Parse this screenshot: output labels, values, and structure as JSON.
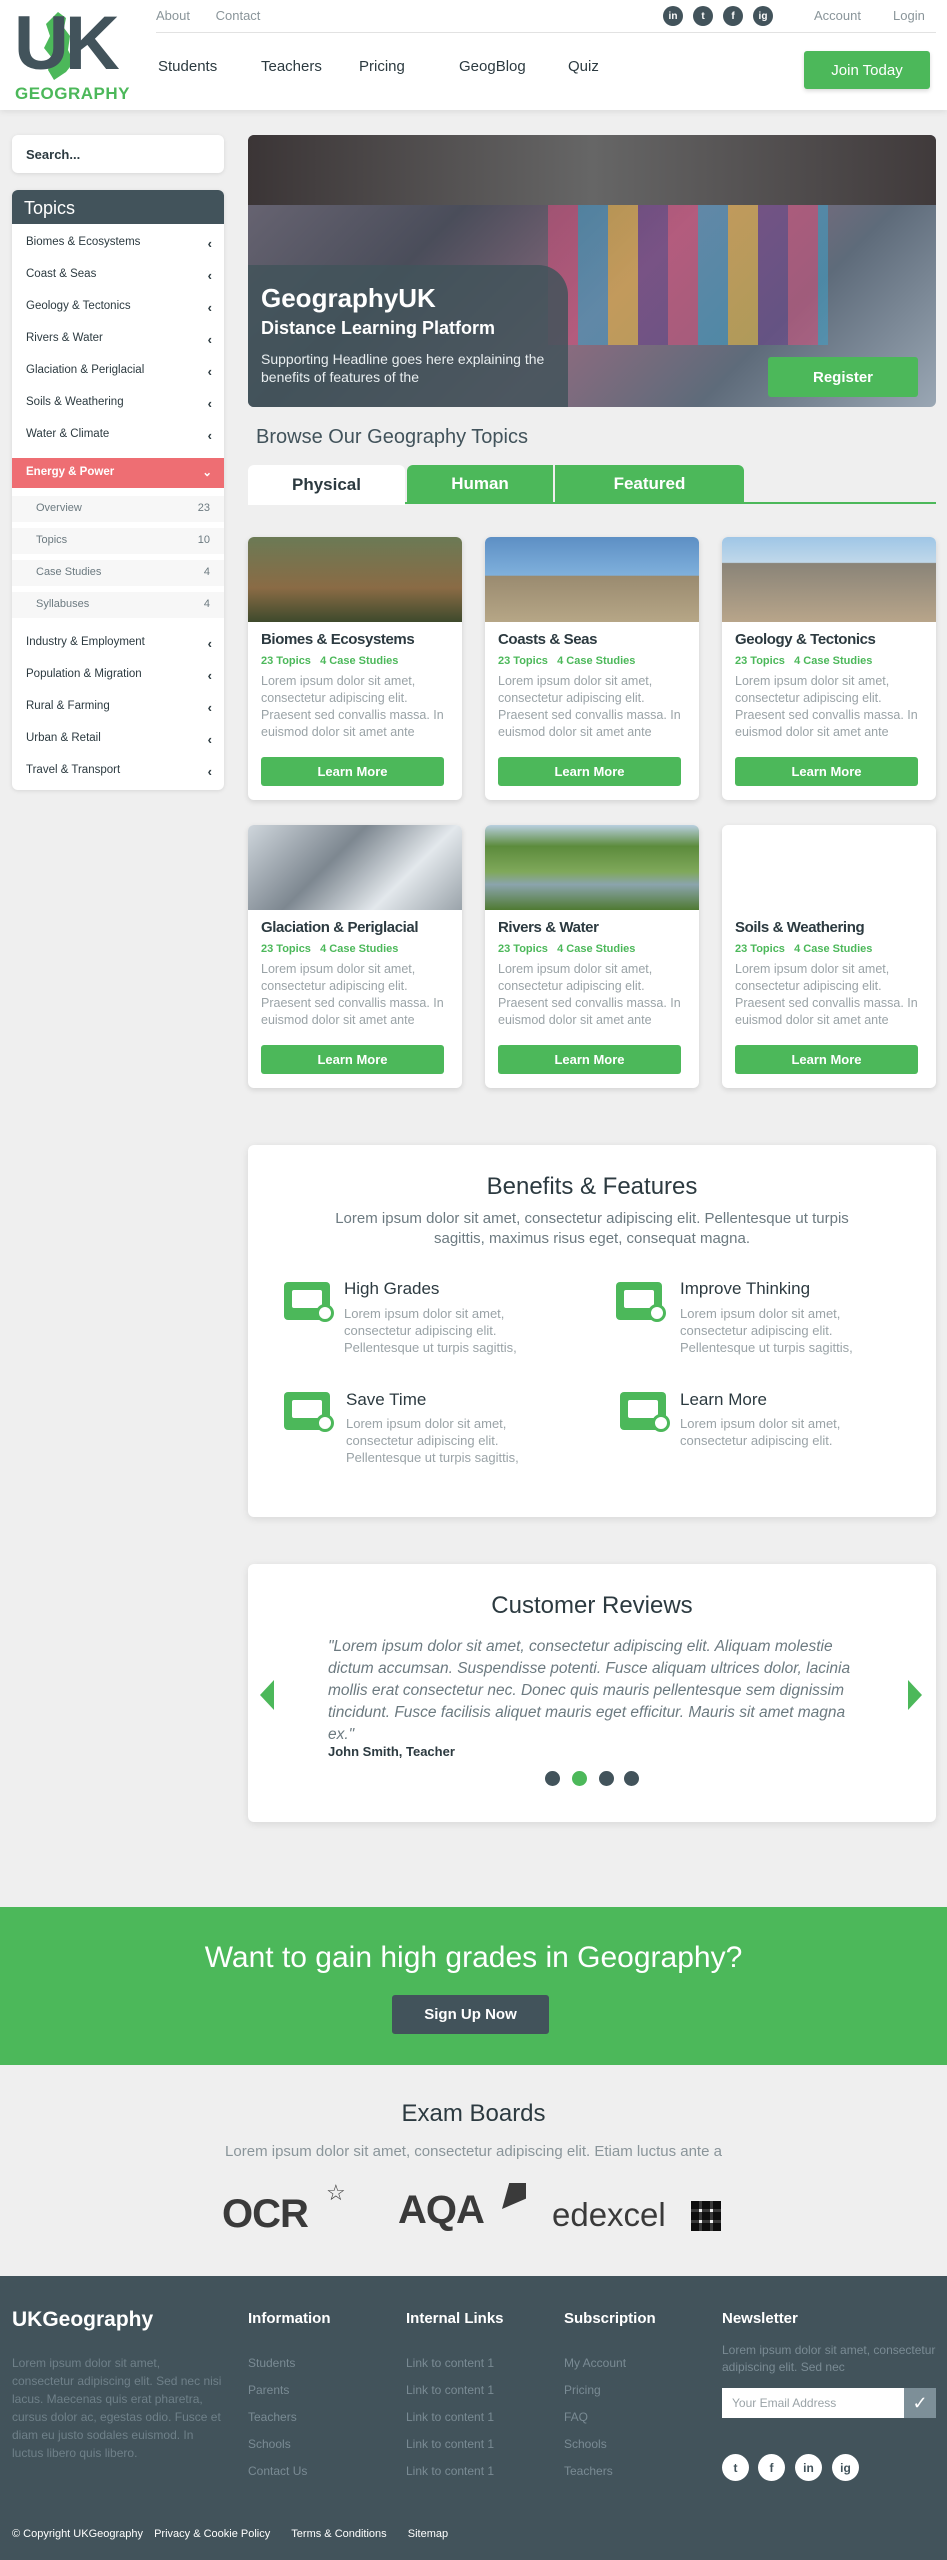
{
  "header": {
    "logo_text": "UK",
    "logo_sub": "GEOGRAPHY",
    "top_links": [
      "About",
      "Contact"
    ],
    "social": [
      "in",
      "t",
      "f",
      "ig"
    ],
    "account": "Account",
    "login": "Login",
    "nav": [
      "Students",
      "Teachers",
      "Pricing",
      "GeogBlog",
      "Quiz"
    ],
    "join": "Join Today"
  },
  "search": {
    "placeholder": "Search..."
  },
  "sidebar": {
    "title": "Topics",
    "items": [
      "Biomes & Ecosystems",
      "Coast & Seas",
      "Geology & Tectonics",
      "Rivers & Water",
      "Glaciation & Periglacial",
      "Soils & Weathering",
      "Water & Climate"
    ],
    "active": "Energy & Power",
    "sub": [
      {
        "label": "Overview",
        "count": "23"
      },
      {
        "label": "Topics",
        "count": "10"
      },
      {
        "label": "Case Studies",
        "count": "4"
      },
      {
        "label": "Syllabuses",
        "count": "4"
      }
    ],
    "items_after": [
      "Industry & Employment",
      "Population & Migration",
      "Rural & Farming",
      "Urban & Retail",
      "Travel & Transport"
    ]
  },
  "hero": {
    "title": "GeographyUK",
    "subtitle": "Distance Learning Platform",
    "text": "Supporting Headline goes here explaining the benefits of features of the",
    "register": "Register"
  },
  "browse": {
    "title": "Browse Our Geography Topics",
    "tabs": [
      "Physical",
      "Human",
      "Featured"
    ]
  },
  "cards": [
    {
      "title": "Biomes & Ecosystems",
      "topics": "23 Topics",
      "cases": "4 Case Studies",
      "text": "Lorem ipsum dolor sit amet, consectetur adipiscing elit. Praesent sed convallis massa. In euismod dolor sit amet ante",
      "button": "Learn More"
    },
    {
      "title": "Coasts & Seas",
      "topics": "23 Topics",
      "cases": "4 Case Studies",
      "text": "Lorem ipsum dolor sit amet, consectetur adipiscing elit. Praesent sed convallis massa. In euismod dolor sit amet ante",
      "button": "Learn More"
    },
    {
      "title": "Geology & Tectonics",
      "topics": "23 Topics",
      "cases": "4 Case Studies",
      "text": "Lorem ipsum dolor sit amet, consectetur adipiscing elit. Praesent sed convallis massa. In euismod dolor sit amet ante",
      "button": "Learn More"
    },
    {
      "title": "Glaciation & Periglacial",
      "topics": "23 Topics",
      "cases": "4 Case Studies",
      "text": "Lorem ipsum dolor sit amet, consectetur adipiscing elit. Praesent sed convallis massa. In euismod dolor sit amet ante",
      "button": "Learn More"
    },
    {
      "title": "Rivers & Water",
      "topics": "23 Topics",
      "cases": "4 Case Studies",
      "text": "Lorem ipsum dolor sit amet, consectetur adipiscing elit. Praesent sed convallis massa. In euismod dolor sit amet ante",
      "button": "Learn More"
    },
    {
      "title": "Soils & Weathering",
      "topics": "23 Topics",
      "cases": "4 Case Studies",
      "text": "Lorem ipsum dolor sit amet, consectetur adipiscing elit. Praesent sed convallis massa. In euismod dolor sit amet ante",
      "button": "Learn More"
    }
  ],
  "benefits": {
    "title": "Benefits & Features",
    "subtitle": "Lorem ipsum dolor sit amet, consectetur adipiscing elit. Pellentesque ut turpis sagittis, maximus risus eget, consequat magna.",
    "features": [
      {
        "title": "High Grades",
        "text": "Lorem ipsum dolor sit amet, consectetur adipiscing elit. Pellentesque ut turpis sagittis,"
      },
      {
        "title": "Improve Thinking",
        "text": "Lorem ipsum dolor sit amet, consectetur adipiscing elit. Pellentesque ut turpis sagittis,"
      },
      {
        "title": "Save Time",
        "text": "Lorem ipsum dolor sit amet, consectetur adipiscing elit. Pellentesque ut turpis sagittis,"
      },
      {
        "title": "Learn More",
        "text": "Lorem ipsum dolor sit amet, consectetur adipiscing elit."
      }
    ]
  },
  "reviews": {
    "title": "Customer Reviews",
    "quote": "\"Lorem ipsum dolor sit amet, consectetur adipiscing elit. Aliquam molestie dictum accumsan. Suspendisse potenti. Fusce aliquam ultrices dolor, lacinia mollis erat consectetur nec. Donec quis mauris pellentesque sem dignissim tincidunt. Fusce facilisis aliquet mauris eget efficitur. Mauris sit amet magna ex.\"",
    "author": "John Smith, Teacher"
  },
  "cta": {
    "title": "Want to gain high grades in Geography?",
    "button": "Sign Up Now"
  },
  "exam": {
    "title": "Exam Boards",
    "subtitle": "Lorem ipsum dolor sit amet, consectetur adipiscing elit. Etiam luctus ante a",
    "logos": [
      "OCR",
      "AQA",
      "edexcel"
    ]
  },
  "footer": {
    "brand": "UKGeography",
    "about": "Lorem ipsum dolor sit amet, consectetur adipiscing elit. Sed nec nisi lacus. Maecenas quis erat pharetra, cursus dolor ac, egestas odio. Fusce et diam eu justo sodales euismod. In luctus libero quis libero.",
    "information": {
      "title": "Information",
      "links": [
        "Students",
        "Parents",
        "Teachers",
        "Schools",
        "Contact Us"
      ]
    },
    "internal": {
      "title": "Internal Links",
      "links": [
        "Link to content 1",
        "Link to content 1",
        "Link to content 1",
        "Link to content 1",
        "Link to content 1"
      ]
    },
    "subscription": {
      "title": "Subscription",
      "links": [
        "My Account",
        "Pricing",
        "FAQ",
        "Schools",
        "Teachers"
      ]
    },
    "newsletter": {
      "title": "Newsletter",
      "text": "Lorem ipsum dolor sit amet, consectetur adipiscing elit. Sed nec",
      "placeholder": "Your Email Address"
    },
    "social": [
      "t",
      "f",
      "in",
      "ig"
    ],
    "copyright": "© Copyright UKGeography",
    "bottom_links": [
      "Privacy & Cookie Policy",
      "Terms & Conditions",
      "Sitemap"
    ]
  }
}
